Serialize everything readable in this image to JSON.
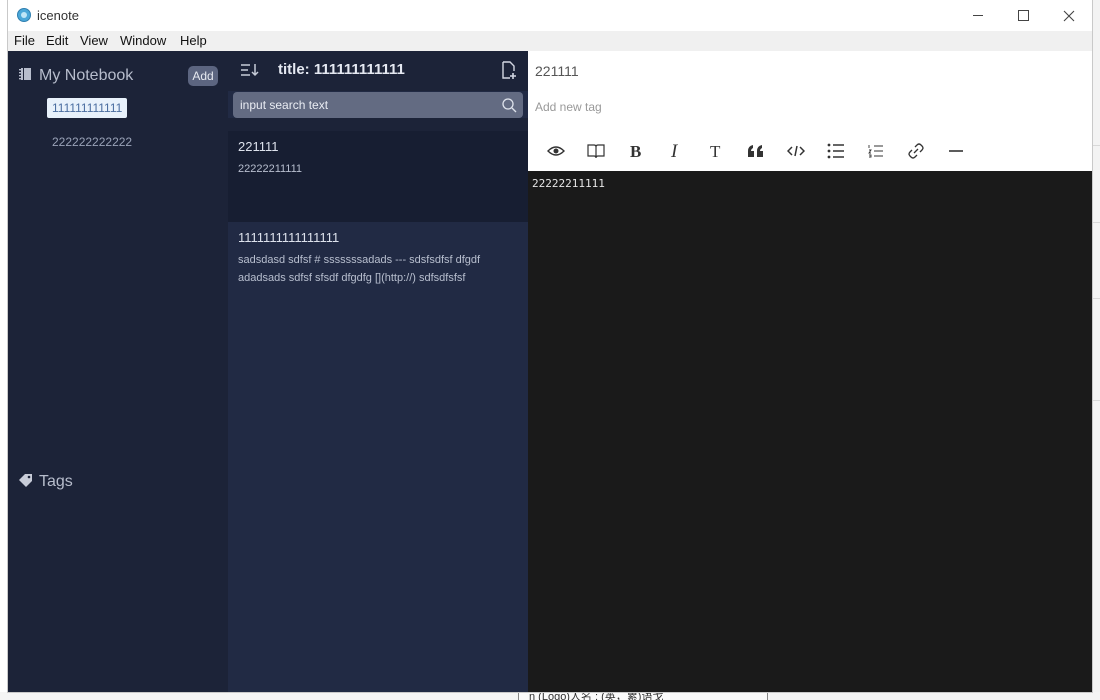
{
  "window": {
    "title": "icenote"
  },
  "menu": [
    "File",
    "Edit",
    "View",
    "Window",
    "Help"
  ],
  "sidebar": {
    "notebook_title": "My Notebook",
    "add_label": "Add",
    "notebooks": [
      "111111111111",
      "222222222222"
    ],
    "active_notebook": 0,
    "tags_title": "Tags"
  },
  "notelist": {
    "title": "title: 111111111111",
    "search_placeholder": "input search text",
    "notes": [
      {
        "title": "221111",
        "excerpt": "22222211111",
        "active": true
      },
      {
        "title": "1111111111111111",
        "excerpt": "sadsdasd sdfsf # sssssssadads --- sdsfsdfsf dfgdf adadsads sdfsf sfsdf dfgdfg [](http://) sdfsdfsfsf",
        "active": false
      }
    ]
  },
  "editor": {
    "title": "221111",
    "tag_placeholder": "Add new tag",
    "content": "22222211111",
    "toolbar": [
      "preview-icon",
      "book-icon",
      "bold-icon",
      "italic-icon",
      "heading-icon",
      "quote-icon",
      "code-icon",
      "unordered-list-icon",
      "ordered-list-icon",
      "link-icon",
      "horizontal-rule-icon"
    ]
  },
  "background": {
    "snippet": "n (Logo)人名 : (英，累)语戈"
  },
  "colors": {
    "sidebar": "#1c2338",
    "notelist": "#212a44",
    "active_note": "#171e32",
    "editor": "#1a1a1a",
    "search": "#636b82",
    "add_button": "#5c6580"
  }
}
